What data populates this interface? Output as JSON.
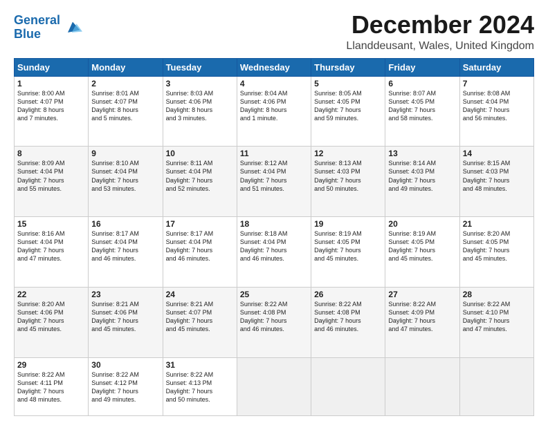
{
  "header": {
    "logo_line1": "General",
    "logo_line2": "Blue",
    "title": "December 2024",
    "subtitle": "Llanddeusant, Wales, United Kingdom"
  },
  "days_of_week": [
    "Sunday",
    "Monday",
    "Tuesday",
    "Wednesday",
    "Thursday",
    "Friday",
    "Saturday"
  ],
  "weeks": [
    [
      {
        "day": 1,
        "info": "Sunrise: 8:00 AM\nSunset: 4:07 PM\nDaylight: 8 hours\nand 7 minutes."
      },
      {
        "day": 2,
        "info": "Sunrise: 8:01 AM\nSunset: 4:07 PM\nDaylight: 8 hours\nand 5 minutes."
      },
      {
        "day": 3,
        "info": "Sunrise: 8:03 AM\nSunset: 4:06 PM\nDaylight: 8 hours\nand 3 minutes."
      },
      {
        "day": 4,
        "info": "Sunrise: 8:04 AM\nSunset: 4:06 PM\nDaylight: 8 hours\nand 1 minute."
      },
      {
        "day": 5,
        "info": "Sunrise: 8:05 AM\nSunset: 4:05 PM\nDaylight: 7 hours\nand 59 minutes."
      },
      {
        "day": 6,
        "info": "Sunrise: 8:07 AM\nSunset: 4:05 PM\nDaylight: 7 hours\nand 58 minutes."
      },
      {
        "day": 7,
        "info": "Sunrise: 8:08 AM\nSunset: 4:04 PM\nDaylight: 7 hours\nand 56 minutes."
      }
    ],
    [
      {
        "day": 8,
        "info": "Sunrise: 8:09 AM\nSunset: 4:04 PM\nDaylight: 7 hours\nand 55 minutes."
      },
      {
        "day": 9,
        "info": "Sunrise: 8:10 AM\nSunset: 4:04 PM\nDaylight: 7 hours\nand 53 minutes."
      },
      {
        "day": 10,
        "info": "Sunrise: 8:11 AM\nSunset: 4:04 PM\nDaylight: 7 hours\nand 52 minutes."
      },
      {
        "day": 11,
        "info": "Sunrise: 8:12 AM\nSunset: 4:04 PM\nDaylight: 7 hours\nand 51 minutes."
      },
      {
        "day": 12,
        "info": "Sunrise: 8:13 AM\nSunset: 4:03 PM\nDaylight: 7 hours\nand 50 minutes."
      },
      {
        "day": 13,
        "info": "Sunrise: 8:14 AM\nSunset: 4:03 PM\nDaylight: 7 hours\nand 49 minutes."
      },
      {
        "day": 14,
        "info": "Sunrise: 8:15 AM\nSunset: 4:03 PM\nDaylight: 7 hours\nand 48 minutes."
      }
    ],
    [
      {
        "day": 15,
        "info": "Sunrise: 8:16 AM\nSunset: 4:04 PM\nDaylight: 7 hours\nand 47 minutes."
      },
      {
        "day": 16,
        "info": "Sunrise: 8:17 AM\nSunset: 4:04 PM\nDaylight: 7 hours\nand 46 minutes."
      },
      {
        "day": 17,
        "info": "Sunrise: 8:17 AM\nSunset: 4:04 PM\nDaylight: 7 hours\nand 46 minutes."
      },
      {
        "day": 18,
        "info": "Sunrise: 8:18 AM\nSunset: 4:04 PM\nDaylight: 7 hours\nand 46 minutes."
      },
      {
        "day": 19,
        "info": "Sunrise: 8:19 AM\nSunset: 4:05 PM\nDaylight: 7 hours\nand 45 minutes."
      },
      {
        "day": 20,
        "info": "Sunrise: 8:19 AM\nSunset: 4:05 PM\nDaylight: 7 hours\nand 45 minutes."
      },
      {
        "day": 21,
        "info": "Sunrise: 8:20 AM\nSunset: 4:05 PM\nDaylight: 7 hours\nand 45 minutes."
      }
    ],
    [
      {
        "day": 22,
        "info": "Sunrise: 8:20 AM\nSunset: 4:06 PM\nDaylight: 7 hours\nand 45 minutes."
      },
      {
        "day": 23,
        "info": "Sunrise: 8:21 AM\nSunset: 4:06 PM\nDaylight: 7 hours\nand 45 minutes."
      },
      {
        "day": 24,
        "info": "Sunrise: 8:21 AM\nSunset: 4:07 PM\nDaylight: 7 hours\nand 45 minutes."
      },
      {
        "day": 25,
        "info": "Sunrise: 8:22 AM\nSunset: 4:08 PM\nDaylight: 7 hours\nand 46 minutes."
      },
      {
        "day": 26,
        "info": "Sunrise: 8:22 AM\nSunset: 4:08 PM\nDaylight: 7 hours\nand 46 minutes."
      },
      {
        "day": 27,
        "info": "Sunrise: 8:22 AM\nSunset: 4:09 PM\nDaylight: 7 hours\nand 47 minutes."
      },
      {
        "day": 28,
        "info": "Sunrise: 8:22 AM\nSunset: 4:10 PM\nDaylight: 7 hours\nand 47 minutes."
      }
    ],
    [
      {
        "day": 29,
        "info": "Sunrise: 8:22 AM\nSunset: 4:11 PM\nDaylight: 7 hours\nand 48 minutes."
      },
      {
        "day": 30,
        "info": "Sunrise: 8:22 AM\nSunset: 4:12 PM\nDaylight: 7 hours\nand 49 minutes."
      },
      {
        "day": 31,
        "info": "Sunrise: 8:22 AM\nSunset: 4:13 PM\nDaylight: 7 hours\nand 50 minutes."
      },
      null,
      null,
      null,
      null
    ]
  ]
}
